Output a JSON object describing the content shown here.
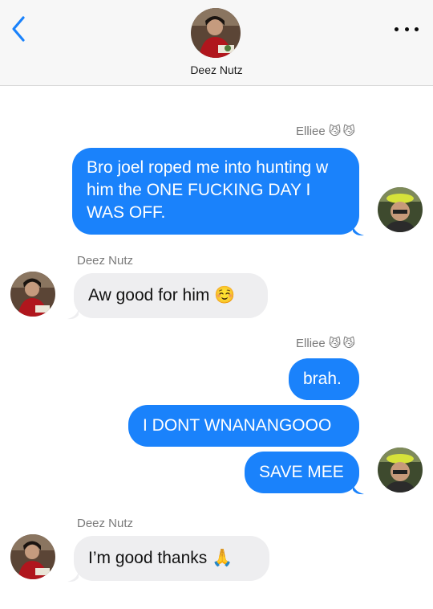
{
  "header": {
    "contact_name": "Deez Nutz",
    "back_icon": "chevron-left-icon",
    "more_icon": "ellipsis-icon"
  },
  "colors": {
    "accent": "#1a82fb",
    "incoming_bubble": "#eeeef0",
    "header_bg": "#f7f7f7"
  },
  "messages": [
    {
      "sender": "Elliee",
      "sender_emoji": "😼😼",
      "direction": "outgoing",
      "text": "Bro joel roped me into hunting w him the ONE FUCKING DAY I WAS OFF."
    },
    {
      "sender": "Deez Nutz",
      "direction": "incoming",
      "text": "Aw good for him ☺️"
    },
    {
      "sender": "Elliee",
      "sender_emoji": "😼😼",
      "direction": "outgoing",
      "text": "brah."
    },
    {
      "direction": "outgoing",
      "text": "I DONT WNANANGOOO"
    },
    {
      "direction": "outgoing",
      "text": "SAVE MEE"
    },
    {
      "sender": "Deez Nutz",
      "direction": "incoming",
      "text": "I’m good thanks 🙏"
    }
  ]
}
